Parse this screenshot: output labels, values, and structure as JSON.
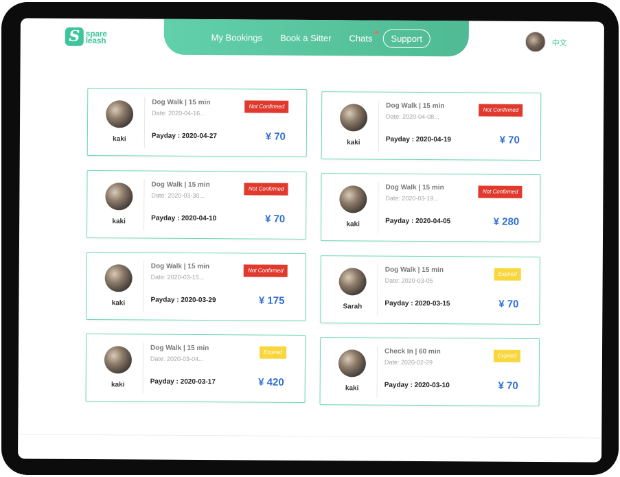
{
  "brand": {
    "line1": "spare",
    "line2": "leash",
    "mark": "S"
  },
  "nav": {
    "items": [
      "My Bookings",
      "Book a Sitter",
      "Chats"
    ],
    "support": "Support"
  },
  "header": {
    "lang": "中文",
    "avatar_icon": "user-avatar"
  },
  "colors": {
    "accent": "#4fba94",
    "price": "#2f6fd1",
    "not_confirmed": "#e03a2f",
    "expired": "#f8d63c"
  },
  "bookings": [
    {
      "name": "kaki",
      "service": "Dog Walk | 15 min",
      "date": "Date: 2020-04-16...",
      "payday": "Payday : 2020-04-27",
      "price": "¥ 70",
      "status": "Not Confirmed"
    },
    {
      "name": "kaki",
      "service": "Dog Walk | 15 min",
      "date": "Date: 2020-04-08...",
      "payday": "Payday : 2020-04-19",
      "price": "¥ 70",
      "status": "Not Confirmed"
    },
    {
      "name": "kaki",
      "service": "Dog Walk | 15 min",
      "date": "Date: 2020-03-30...",
      "payday": "Payday : 2020-04-10",
      "price": "¥ 70",
      "status": "Not Confirmed"
    },
    {
      "name": "kaki",
      "service": "Dog Walk | 15 min",
      "date": "Date: 2020-03-19...",
      "payday": "Payday : 2020-04-05",
      "price": "¥ 280",
      "status": "Not Confirmed"
    },
    {
      "name": "kaki",
      "service": "Dog Walk | 15 min",
      "date": "Date: 2020-03-15...",
      "payday": "Payday : 2020-03-29",
      "price": "¥ 175",
      "status": "Not Confirmed"
    },
    {
      "name": "Sarah",
      "service": "Dog Walk | 15 min",
      "date": "Date: 2020-03-05",
      "payday": "Payday : 2020-03-15",
      "price": "¥ 70",
      "status": "Expired"
    },
    {
      "name": "kaki",
      "service": "Dog Walk | 15 min",
      "date": "Date: 2020-03-04...",
      "payday": "Payday : 2020-03-17",
      "price": "¥ 420",
      "status": "Expired"
    },
    {
      "name": "kaki",
      "service": "Check In | 60 min",
      "date": "Date: 2020-02-29",
      "payday": "Payday : 2020-03-10",
      "price": "¥ 70",
      "status": "Expired"
    }
  ]
}
